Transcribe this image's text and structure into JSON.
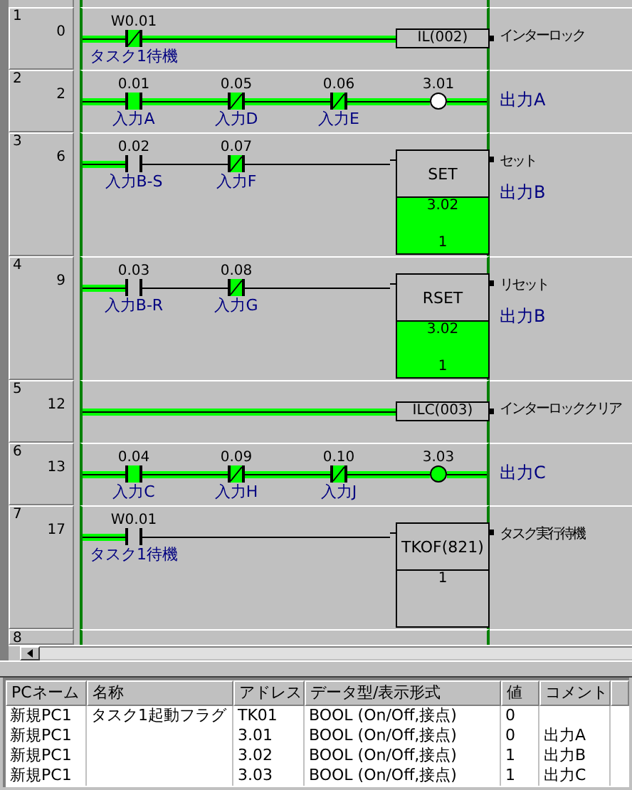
{
  "rungs": [
    {
      "number": "1",
      "step": "0",
      "contacts": [
        {
          "kind": "nc",
          "address": "W0.01",
          "label": "タスク1待機",
          "on": true
        }
      ],
      "output": {
        "kind": "instruction",
        "text": "IL(002)"
      },
      "comments": [
        {
          "kind": "rung",
          "text": "インターロック"
        }
      ]
    },
    {
      "number": "2",
      "step": "2",
      "contacts": [
        {
          "kind": "no",
          "address": "0.01",
          "label": "入力A",
          "on": true
        },
        {
          "kind": "nc",
          "address": "0.05",
          "label": "入力D",
          "on": true
        },
        {
          "kind": "nc",
          "address": "0.06",
          "label": "入力E",
          "on": true
        }
      ],
      "output": {
        "kind": "coil",
        "address": "3.01",
        "on": false
      },
      "comments": [
        {
          "kind": "io",
          "text": "出力A"
        }
      ]
    },
    {
      "number": "3",
      "step": "6",
      "contacts": [
        {
          "kind": "no",
          "address": "0.02",
          "label": "入力B-S",
          "on": false
        },
        {
          "kind": "nc",
          "address": "0.07",
          "label": "入力F",
          "on": true
        }
      ],
      "output": {
        "kind": "function_box",
        "text": "SET",
        "operand": "3.02",
        "value": "1",
        "on": true
      },
      "comments": [
        {
          "kind": "rung",
          "text": "セット"
        },
        {
          "kind": "io",
          "text": "出力B"
        }
      ]
    },
    {
      "number": "4",
      "step": "9",
      "contacts": [
        {
          "kind": "no",
          "address": "0.03",
          "label": "入力B-R",
          "on": false
        },
        {
          "kind": "nc",
          "address": "0.08",
          "label": "入力G",
          "on": true
        }
      ],
      "output": {
        "kind": "function_box",
        "text": "RSET",
        "operand": "3.02",
        "value": "1",
        "on": true
      },
      "comments": [
        {
          "kind": "rung",
          "text": "リセット"
        },
        {
          "kind": "io",
          "text": "出力B"
        }
      ]
    },
    {
      "number": "5",
      "step": "12",
      "output": {
        "kind": "instruction",
        "text": "ILC(003)"
      },
      "comments": [
        {
          "kind": "rung",
          "text": "インターロッククリア"
        }
      ]
    },
    {
      "number": "6",
      "step": "13",
      "contacts": [
        {
          "kind": "no",
          "address": "0.04",
          "label": "入力C",
          "on": true
        },
        {
          "kind": "nc",
          "address": "0.09",
          "label": "入力H",
          "on": true
        },
        {
          "kind": "nc",
          "address": "0.10",
          "label": "入力J",
          "on": true
        }
      ],
      "output": {
        "kind": "coil",
        "address": "3.03",
        "on": true
      },
      "comments": [
        {
          "kind": "io",
          "text": "出力C"
        }
      ]
    },
    {
      "number": "7",
      "step": "17",
      "contacts": [
        {
          "kind": "no",
          "address": "W0.01",
          "label": "タスク1待機",
          "on": false
        }
      ],
      "output": {
        "kind": "function_box",
        "text": "TKOF(821)",
        "value": "1",
        "on": false
      },
      "comments": [
        {
          "kind": "rung",
          "text": "タスク実行待機"
        }
      ]
    },
    {
      "number": "8"
    }
  ],
  "watch_table": {
    "columns": [
      "PCネーム",
      "名称",
      "アドレス",
      "データ型/表示形式",
      "値",
      "コメント"
    ],
    "rows": [
      [
        "新規PC1",
        "タスク1起動フラグ",
        "TK01",
        "BOOL (On/Off,接点)",
        "0",
        ""
      ],
      [
        "新規PC1",
        "",
        "3.01",
        "BOOL (On/Off,接点)",
        "0",
        "出力A"
      ],
      [
        "新規PC1",
        "",
        "3.02",
        "BOOL (On/Off,接点)",
        "1",
        "出力B"
      ],
      [
        "新規PC1",
        "",
        "3.03",
        "BOOL (On/Off,接点)",
        "1",
        "出力C"
      ]
    ]
  }
}
